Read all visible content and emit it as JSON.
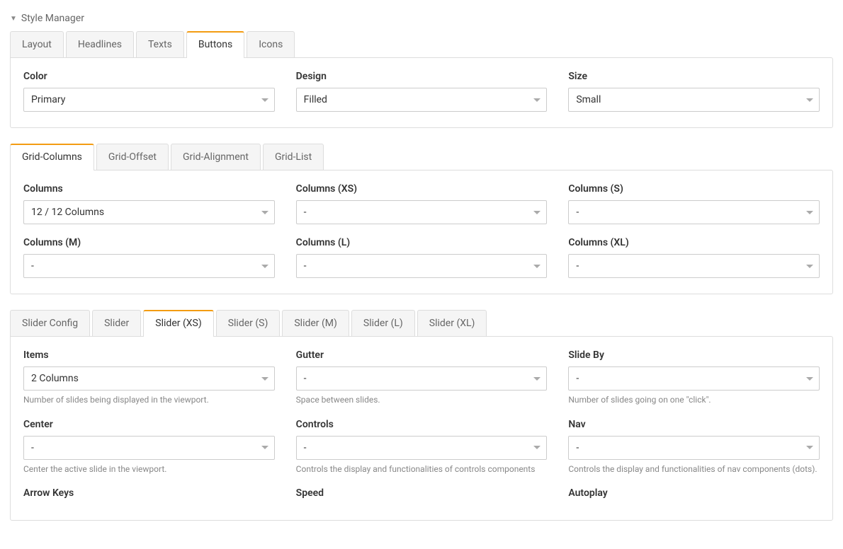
{
  "header": {
    "title": "Style Manager"
  },
  "group1": {
    "tabs": [
      "Layout",
      "Headlines",
      "Texts",
      "Buttons",
      "Icons"
    ],
    "active_index": 3,
    "fields": [
      {
        "label": "Color",
        "value": "Primary"
      },
      {
        "label": "Design",
        "value": "Filled"
      },
      {
        "label": "Size",
        "value": "Small"
      }
    ]
  },
  "group2": {
    "tabs": [
      "Grid-Columns",
      "Grid-Offset",
      "Grid-Alignment",
      "Grid-List"
    ],
    "active_index": 0,
    "rows": [
      [
        {
          "label": "Columns",
          "value": "12 / 12 Columns"
        },
        {
          "label": "Columns (XS)",
          "value": "-"
        },
        {
          "label": "Columns (S)",
          "value": "-"
        }
      ],
      [
        {
          "label": "Columns (M)",
          "value": "-"
        },
        {
          "label": "Columns (L)",
          "value": "-"
        },
        {
          "label": "Columns (XL)",
          "value": "-"
        }
      ]
    ]
  },
  "group3": {
    "tabs": [
      "Slider Config",
      "Slider",
      "Slider (XS)",
      "Slider (S)",
      "Slider (M)",
      "Slider (L)",
      "Slider (XL)"
    ],
    "active_index": 2,
    "rows": [
      [
        {
          "label": "Items",
          "value": "2 Columns",
          "help": "Number of slides being displayed in the viewport."
        },
        {
          "label": "Gutter",
          "value": "-",
          "help": "Space between slides."
        },
        {
          "label": "Slide By",
          "value": "-",
          "help": "Number of slides going on one \"click\"."
        }
      ],
      [
        {
          "label": "Center",
          "value": "-",
          "help": "Center the active slide in the viewport."
        },
        {
          "label": "Controls",
          "value": "-",
          "help": "Controls the display and functionalities of controls components"
        },
        {
          "label": "Nav",
          "value": "-",
          "help": "Controls the display and functionalities of nav components (dots)."
        }
      ],
      [
        {
          "label": "Arrow Keys",
          "value": "",
          "help": ""
        },
        {
          "label": "Speed",
          "value": "",
          "help": ""
        },
        {
          "label": "Autoplay",
          "value": "",
          "help": ""
        }
      ]
    ]
  }
}
